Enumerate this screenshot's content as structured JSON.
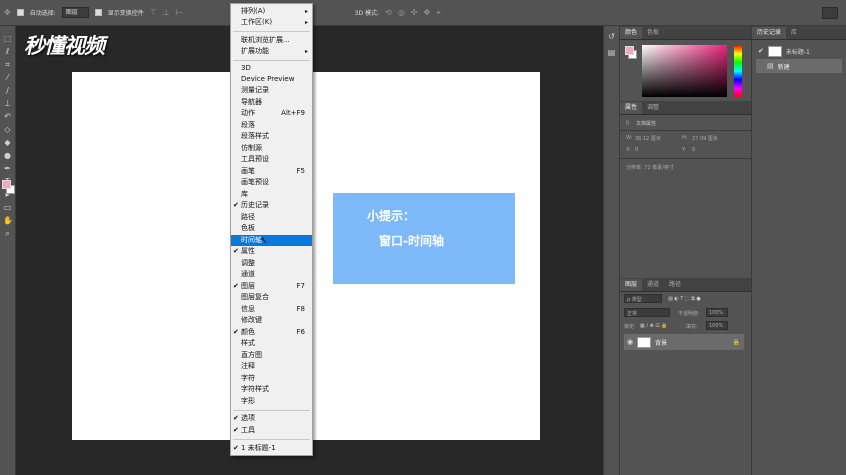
{
  "options_bar": {
    "auto_select_label": "自动选择:",
    "auto_select_value": "图层",
    "transform_label": "显示变换控件",
    "mode_label": "3D 模式:"
  },
  "logo_text": "秒懂视频",
  "tip": {
    "line1": "小提示：",
    "line2": "窗口-时间轴"
  },
  "menu": {
    "items": [
      {
        "label": "排列(A)",
        "arrow": "▸",
        "check": "",
        "shortcut": ""
      },
      {
        "label": "工作区(K)",
        "arrow": "▸",
        "check": "",
        "shortcut": ""
      },
      {
        "label": "联机浏览扩展...",
        "arrow": "",
        "check": "",
        "shortcut": ""
      },
      {
        "label": "扩展功能",
        "arrow": "▸",
        "check": "",
        "shortcut": ""
      },
      {
        "label": "3D",
        "arrow": "",
        "check": "",
        "shortcut": ""
      },
      {
        "label": "Device Preview",
        "arrow": "",
        "check": "",
        "shortcut": ""
      },
      {
        "label": "测量记录",
        "arrow": "",
        "check": "",
        "shortcut": ""
      },
      {
        "label": "导航器",
        "arrow": "",
        "check": "",
        "shortcut": ""
      },
      {
        "label": "动作",
        "arrow": "",
        "check": "",
        "shortcut": "Alt+F9"
      },
      {
        "label": "段落",
        "arrow": "",
        "check": "",
        "shortcut": ""
      },
      {
        "label": "段落样式",
        "arrow": "",
        "check": "",
        "shortcut": ""
      },
      {
        "label": "仿制源",
        "arrow": "",
        "check": "",
        "shortcut": ""
      },
      {
        "label": "工具预设",
        "arrow": "",
        "check": "",
        "shortcut": ""
      },
      {
        "label": "画笔",
        "arrow": "",
        "check": "",
        "shortcut": "F5"
      },
      {
        "label": "画笔预设",
        "arrow": "",
        "check": "",
        "shortcut": ""
      },
      {
        "label": "库",
        "arrow": "",
        "check": "",
        "shortcut": ""
      },
      {
        "label": "历史记录",
        "arrow": "",
        "check": "✔",
        "shortcut": ""
      },
      {
        "label": "路径",
        "arrow": "",
        "check": "",
        "shortcut": ""
      },
      {
        "label": "色板",
        "arrow": "",
        "check": "",
        "shortcut": ""
      },
      {
        "label": "时间轴",
        "arrow": "",
        "check": "",
        "shortcut": ""
      },
      {
        "label": "属性",
        "arrow": "",
        "check": "✔",
        "shortcut": ""
      },
      {
        "label": "调整",
        "arrow": "",
        "check": "",
        "shortcut": ""
      },
      {
        "label": "通道",
        "arrow": "",
        "check": "",
        "shortcut": ""
      },
      {
        "label": "图层",
        "arrow": "",
        "check": "✔",
        "shortcut": "F7"
      },
      {
        "label": "图层复合",
        "arrow": "",
        "check": "",
        "shortcut": ""
      },
      {
        "label": "信息",
        "arrow": "",
        "check": "",
        "shortcut": "F8"
      },
      {
        "label": "修改键",
        "arrow": "",
        "check": "",
        "shortcut": ""
      },
      {
        "label": "颜色",
        "arrow": "",
        "check": "✔",
        "shortcut": "F6"
      },
      {
        "label": "样式",
        "arrow": "",
        "check": "",
        "shortcut": ""
      },
      {
        "label": "直方图",
        "arrow": "",
        "check": "",
        "shortcut": ""
      },
      {
        "label": "注释",
        "arrow": "",
        "check": "",
        "shortcut": ""
      },
      {
        "label": "字符",
        "arrow": "",
        "check": "",
        "shortcut": ""
      },
      {
        "label": "字符样式",
        "arrow": "",
        "check": "",
        "shortcut": ""
      },
      {
        "label": "字形",
        "arrow": "",
        "check": "",
        "shortcut": ""
      },
      {
        "label": "选项",
        "arrow": "",
        "check": "✔",
        "shortcut": ""
      },
      {
        "label": "工具",
        "arrow": "",
        "check": "✔",
        "shortcut": ""
      },
      {
        "label": "1 未标题-1",
        "arrow": "",
        "check": "✔",
        "shortcut": ""
      }
    ],
    "highlighted_index": 19
  },
  "color_panel": {
    "tabs": [
      "颜色",
      "色板"
    ],
    "fg_color": "#f0aac0",
    "bg_color": "#ffffff"
  },
  "properties_panel": {
    "tabs": [
      "属性",
      "调整"
    ],
    "doc_label": "文档属性",
    "w_label": "W:",
    "w_value": "36.12 厘米",
    "h_label": "H:",
    "h_value": "27.09 厘米",
    "x_label": "X:",
    "x_value": "0",
    "y_label": "Y:",
    "y_value": "0",
    "resolution": "分辨率: 72 像素/英寸"
  },
  "layers_panel": {
    "tabs": [
      "图层",
      "通道",
      "路径"
    ],
    "filter_label": "ρ 类型",
    "blend_mode": "正常",
    "opacity_label": "不透明度:",
    "opacity_value": "100%",
    "lock_label": "锁定:",
    "fill_label": "填充:",
    "fill_value": "100%",
    "layer_name": "背景"
  },
  "history_panel": {
    "tabs": [
      "历史记录",
      "库"
    ],
    "doc_item": "未标题-1",
    "step_item": "新建"
  }
}
